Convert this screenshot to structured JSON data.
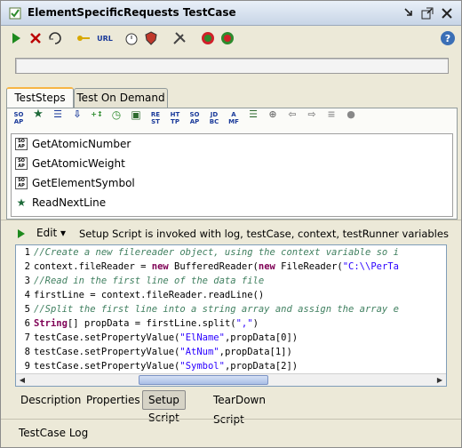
{
  "window": {
    "title": "ElementSpecificRequests TestCase",
    "icons": [
      "testcase-icon",
      "minimize-icon",
      "maximize-icon",
      "close-icon"
    ]
  },
  "toolbar": {
    "run": "run-icon",
    "cancel": "cancel-icon",
    "loop": "loop-icon",
    "credentials": "key-icon",
    "url_label": "URL",
    "timer": "timer-icon",
    "security": "shield-icon",
    "tools": "tools-icon",
    "help": "help-icon"
  },
  "progress": {
    "value": 0,
    "accent": "#6ab04c"
  },
  "tabs": [
    "TestSteps",
    "Test On Demand"
  ],
  "steps_toolbar": [
    {
      "label": "SO AP"
    },
    {
      "label": "★"
    },
    {
      "label": "☰"
    },
    {
      "label": "⇩"
    },
    {
      "label": "+↕"
    },
    {
      "label": "◷"
    },
    {
      "label": "▣"
    },
    {
      "label": "RE ST"
    },
    {
      "label": "HT TP"
    },
    {
      "label": "SO AP"
    },
    {
      "label": "JD BC"
    },
    {
      "label": "A MF"
    },
    {
      "label": "☰"
    },
    {
      "label": "⊕"
    },
    {
      "label": "⇦"
    },
    {
      "label": "⇨"
    },
    {
      "label": "≡"
    },
    {
      "label": "●"
    }
  ],
  "steps": [
    {
      "icon": "SO AP",
      "label": "GetAtomicNumber"
    },
    {
      "icon": "SO AP",
      "label": "GetAtomicWeight"
    },
    {
      "icon": "SO AP",
      "label": "GetElementSymbol"
    },
    {
      "icon": "★",
      "label": "ReadNextLine"
    }
  ],
  "script": {
    "edit_label": "Edit ▾",
    "description": "Setup Script is invoked with log, testCase, context, testRunner variables",
    "lines": [
      {
        "n": "1",
        "text": "//Create a new filereader object, using the context variable so i"
      },
      {
        "n": "2",
        "text": "context.fileReader = new BufferedReader(new FileReader(\"C:\\\\PerTa"
      },
      {
        "n": "3",
        "text": "//Read in the first line of the data file"
      },
      {
        "n": "4",
        "text": "firstLine = context.fileReader.readLine()"
      },
      {
        "n": "5",
        "text": "//Split the first line into a string array and assign the array e"
      },
      {
        "n": "6",
        "text": "String[] propData = firstLine.split(\",\")"
      },
      {
        "n": "7",
        "text": "testCase.setPropertyValue(\"ElName\",propData[0])"
      },
      {
        "n": "8",
        "text": "testCase.setPropertyValue(\"AtNum\",propData[1])"
      },
      {
        "n": "9",
        "text": "testCase.setPropertyValue(\"Symbol\",propData[2])"
      }
    ]
  },
  "bottom_tabs": [
    "Description",
    "Properties",
    "Setup Script",
    "TearDown Script"
  ],
  "footer": {
    "label": "TestCase Log"
  }
}
